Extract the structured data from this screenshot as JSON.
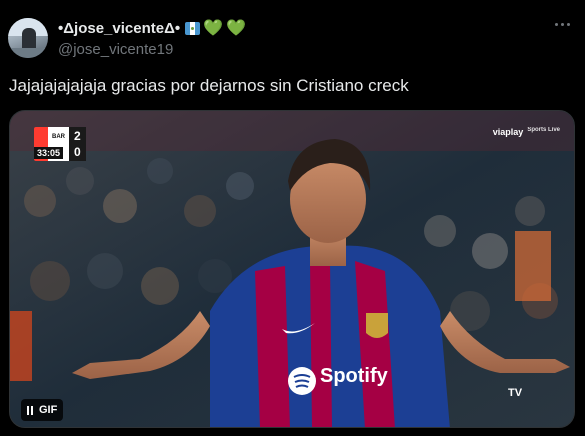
{
  "author": {
    "display_name": "•Δjose_vicenteΔ•",
    "handle": "@jose_vicente19",
    "flag": "guatemala-flag",
    "hearts": [
      "💚",
      "💚"
    ]
  },
  "tweet": {
    "text": "Jajajajajajaja gracias por dejarnos sin Cristiano creck"
  },
  "media": {
    "type": "gif",
    "badge_label": "GIF",
    "scorebug": {
      "team_home": "BAR",
      "team_away": "NT",
      "score_home": "2",
      "score_away": "0",
      "clock": "33:05"
    },
    "broadcaster": "viaplay",
    "broadcaster_sub": "Sports Live",
    "sponsor": "Spotify",
    "corner_logo": "TV"
  },
  "colors": {
    "background": "#000000",
    "text": "#e7e9ea",
    "secondary_text": "#71767b",
    "heart": "#78b159",
    "barca_blue": "#1c3f94",
    "barca_red": "#a50044"
  }
}
